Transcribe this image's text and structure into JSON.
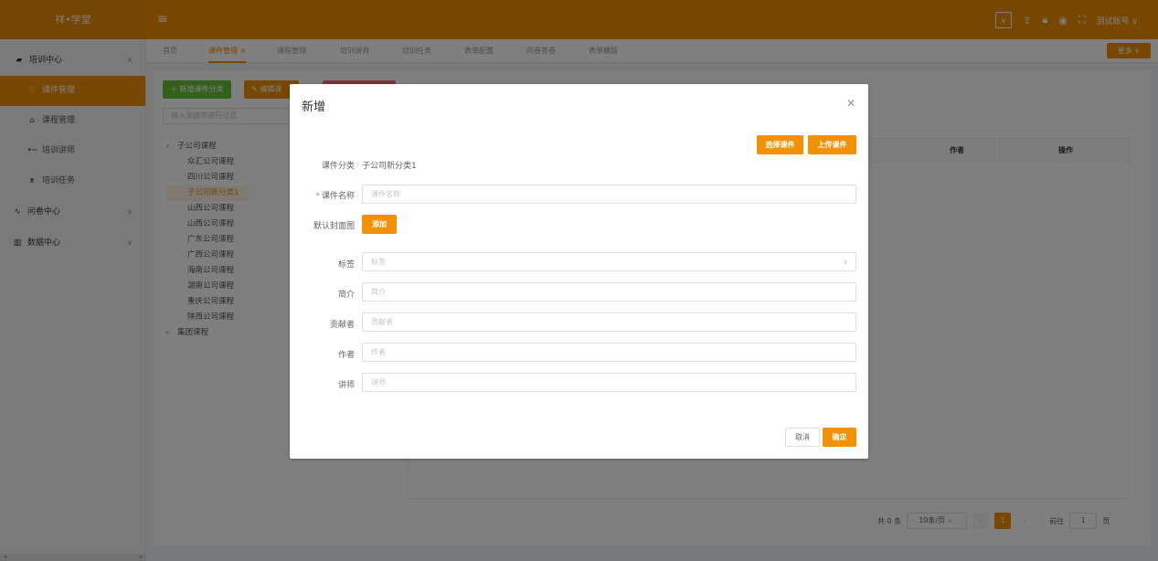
{
  "header": {
    "logo": "祥•学堂",
    "account": "测试账号 ∨"
  },
  "sidebar": {
    "groups": [
      {
        "label": "培训中心",
        "icon": "briefcase-icon"
      },
      {
        "label": "问卷中心",
        "icon": "pulse-icon"
      },
      {
        "label": "数据中心",
        "icon": "bar-chart-icon"
      }
    ],
    "items": [
      {
        "label": "课件管理",
        "icon": "heart-icon",
        "active": true
      },
      {
        "label": "课程管理",
        "icon": "shirt-icon"
      },
      {
        "label": "培训讲师",
        "icon": "pointer-icon"
      },
      {
        "label": "培训任务",
        "icon": "user-icon"
      }
    ]
  },
  "tabs": [
    {
      "label": "首页"
    },
    {
      "label": "课件管理 ×",
      "active": true
    },
    {
      "label": "课程管理"
    },
    {
      "label": "培训讲师"
    },
    {
      "label": "培训任务"
    },
    {
      "label": "表单配置"
    },
    {
      "label": "问卷答卷"
    },
    {
      "label": "表单模版"
    }
  ],
  "more_label": "更多 ∨",
  "toolbar": {
    "add_category": "＋ 新增课件分类",
    "edit_category": "✎ 编辑课"
  },
  "tree": {
    "filter_placeholder": "输入关键字进行过滤",
    "root1": "子公司课程",
    "children": [
      "众汇公司课程",
      "四川公司课程",
      "子公司新分类1",
      "山西公司课程",
      "山西公司课程",
      "广东公司课程",
      "广西公司课程",
      "海南公司课程",
      "湖南公司课程",
      "重庆公司课程",
      "陕西公司课程"
    ],
    "selected_index": 2,
    "root2": "集团课程"
  },
  "table": {
    "col_author": "作者",
    "col_action": "操作"
  },
  "pager": {
    "total": "共 0 条",
    "page_size": "10条/页",
    "current": "1",
    "goto_prefix": "前往",
    "goto_value": "1",
    "goto_suffix": "页"
  },
  "modal": {
    "title": "新增",
    "select_btn": "选择课件",
    "upload_btn": "上传课件",
    "category_label": "课件分类",
    "category_value": "子公司新分类1",
    "name_label": "课件名称",
    "name_placeholder": "课件名称",
    "cover_label": "默认封面图",
    "cover_btn": "添加",
    "tag_label": "标签",
    "tag_placeholder": "标签",
    "intro_label": "简介",
    "intro_placeholder": "简介",
    "contributor_label": "贡献者",
    "contributor_placeholder": "贡献者",
    "author_label": "作者",
    "author_placeholder": "作者",
    "lecturer_label": "讲师",
    "lecturer_placeholder": "讲师",
    "cancel_btn": "取消",
    "confirm_btn": "确定"
  },
  "colors": {
    "brand": "#f19107",
    "danger": "#f56c6c",
    "success": "#67c23a"
  }
}
